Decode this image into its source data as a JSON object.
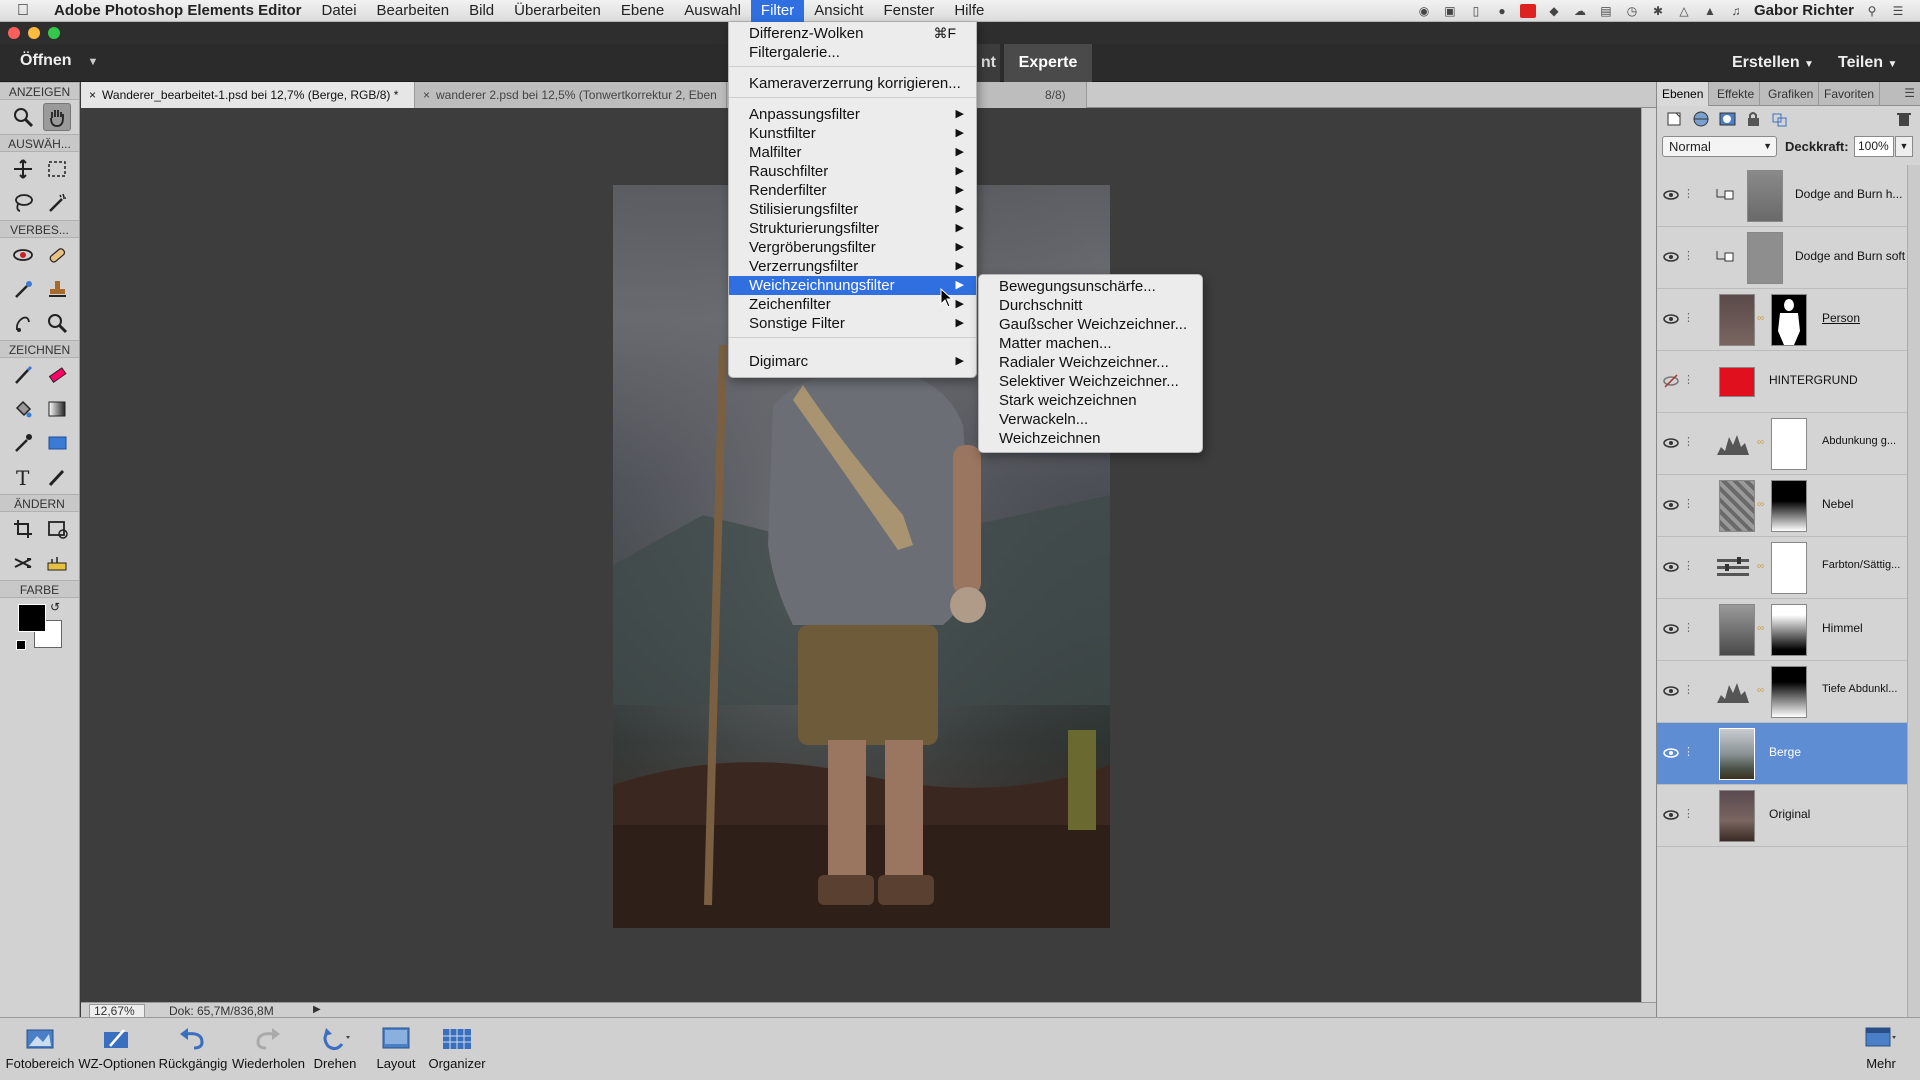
{
  "menubar": {
    "app_name": "Adobe Photoshop Elements Editor",
    "menus": [
      "Datei",
      "Bearbeiten",
      "Bild",
      "Überarbeiten",
      "Ebene",
      "Auswahl",
      "Filter",
      "Ansicht",
      "Fenster",
      "Hilfe"
    ],
    "active_menu": "Filter",
    "user": "Gabor Richter"
  },
  "modebar": {
    "open_label": "Öffnen",
    "mode_partial": "nt",
    "mode_expert": "Experte",
    "create_label": "Erstellen",
    "share_label": "Teilen"
  },
  "toolbox": {
    "sections": [
      "ANZEIGEN",
      "AUSWÄH...",
      "VERBES...",
      "ZEICHNEN",
      "ÄNDERN",
      "FARBE"
    ],
    "colors": {
      "foreground": "#000000",
      "background": "#ffffff"
    }
  },
  "doc_tabs": [
    {
      "label": "Wanderer_bearbeitet-1.psd bei 12,7% (Berge, RGB/8) *",
      "close": "×"
    },
    {
      "label": "wanderer 2.psd bei 12,5% (Tonwertkorrektur 2, Eben",
      "close": "×"
    },
    {
      "label": "8/8)"
    }
  ],
  "statusbar": {
    "zoom": "12,67%",
    "doc": "Dok: 65,7M/836,8M"
  },
  "filter_menu": {
    "items": [
      {
        "label": "Differenz-Wolken",
        "shortcut": "⌘F"
      },
      {
        "label": "Filtergalerie..."
      },
      {
        "label": "Kameraverzerrung korrigieren..."
      },
      {
        "label": "Anpassungsfilter",
        "submenu": "▶"
      },
      {
        "label": "Kunstfilter",
        "submenu": "▶"
      },
      {
        "label": "Malfilter",
        "submenu": "▶"
      },
      {
        "label": "Rauschfilter",
        "submenu": "▶"
      },
      {
        "label": "Renderfilter",
        "submenu": "▶"
      },
      {
        "label": "Stilisierungsfilter",
        "submenu": "▶"
      },
      {
        "label": "Strukturierungsfilter",
        "submenu": "▶"
      },
      {
        "label": "Vergröberungsfilter",
        "submenu": "▶"
      },
      {
        "label": "Verzerrungsfilter",
        "submenu": "▶"
      },
      {
        "label": "Weichzeichnungsfilter",
        "submenu": "▶",
        "highlighted": true
      },
      {
        "label": "Zeichenfilter",
        "submenu": "▶"
      },
      {
        "label": "Sonstige Filter",
        "submenu": "▶"
      },
      {
        "label": "Digimarc",
        "submenu": "▶"
      }
    ]
  },
  "blur_submenu": {
    "items": [
      "Bewegungsunschärfe...",
      "Durchschnitt",
      "Gaußscher Weichzeichner...",
      "Matter machen...",
      "Radialer Weichzeichner...",
      "Selektiver Weichzeichner...",
      "Stark weichzeichnen",
      "Verwackeln...",
      "Weichzeichnen"
    ]
  },
  "panel": {
    "tabs": [
      "Ebenen",
      "Effekte",
      "Grafiken",
      "Favoriten"
    ],
    "active_tab": "Ebenen",
    "blend_mode": "Normal",
    "opacity_label": "Deckkraft:",
    "opacity_value": "100%",
    "layers": [
      {
        "name": "Dodge and Burn h...",
        "visible": true,
        "selected": false
      },
      {
        "name": "Dodge and Burn soft",
        "visible": true,
        "selected": false
      },
      {
        "name": "Person",
        "visible": true,
        "selected": false
      },
      {
        "name": "HINTERGRUND",
        "visible": false,
        "selected": false
      },
      {
        "name": "Abdunkung g...",
        "visible": true,
        "selected": false
      },
      {
        "name": "Nebel",
        "visible": true,
        "selected": false
      },
      {
        "name": "Farbton/Sättig...",
        "visible": true,
        "selected": false
      },
      {
        "name": "Himmel",
        "visible": true,
        "selected": false
      },
      {
        "name": "Tiefe Abdunkl...",
        "visible": true,
        "selected": false
      },
      {
        "name": "Berge",
        "visible": true,
        "selected": true
      },
      {
        "name": "Original",
        "visible": true,
        "selected": false
      }
    ]
  },
  "bottombar": {
    "buttons": [
      "Fotobereich",
      "WZ-Optionen",
      "Rückgängig",
      "Wiederholen",
      "Drehen",
      "Layout",
      "Organizer"
    ],
    "more": "Mehr"
  },
  "colors": {
    "menu_highlight": "#2f6fe0",
    "layer_selected": "#5f8dd3",
    "hintergrund_fill": "#e0101e"
  }
}
